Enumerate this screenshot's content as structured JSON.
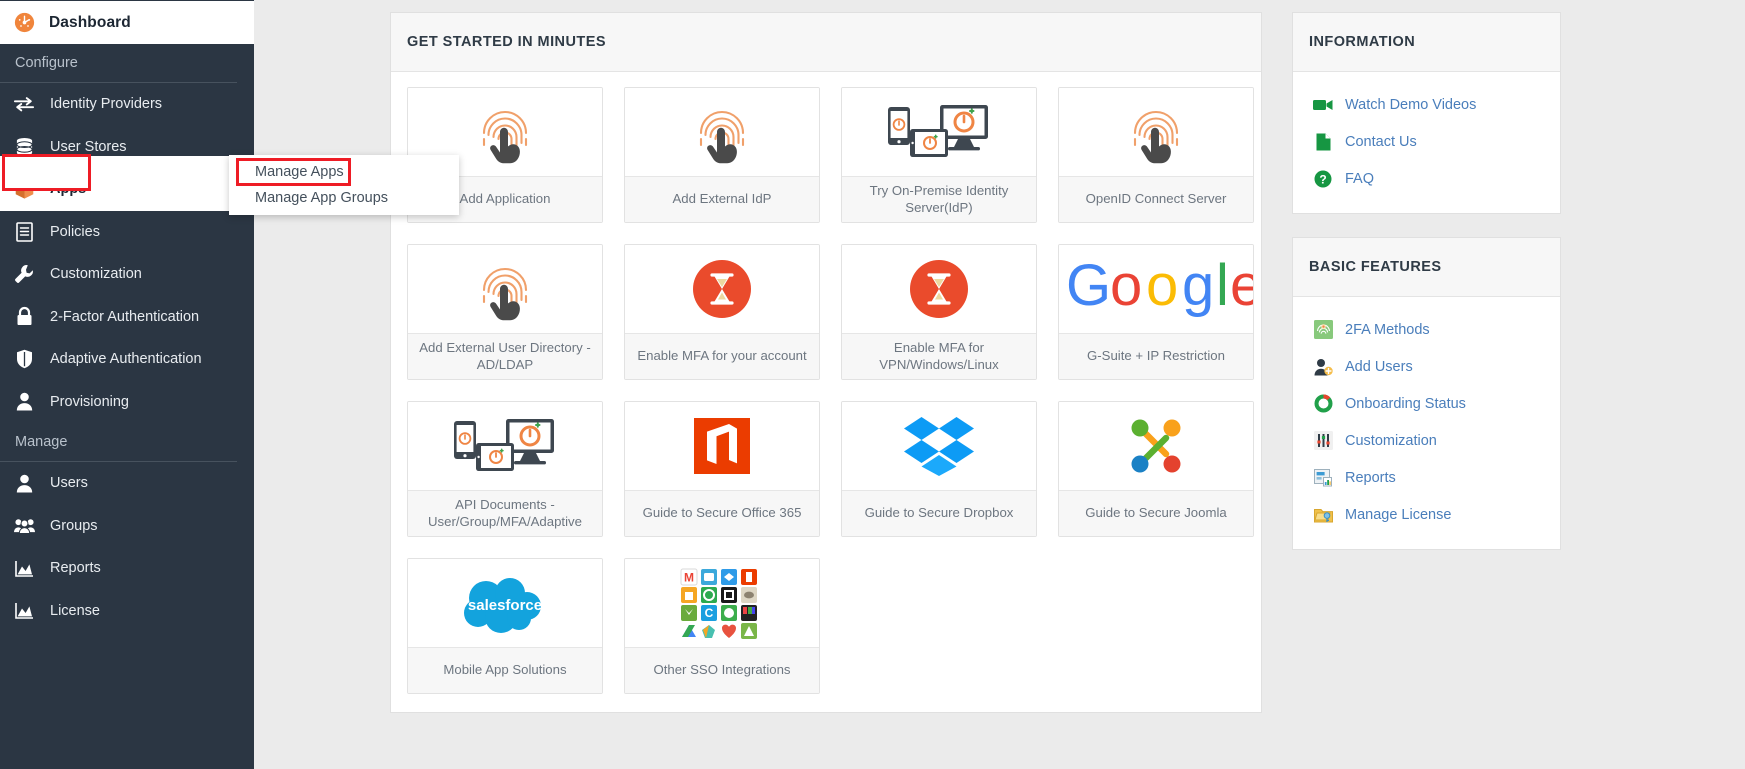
{
  "sidebar": {
    "dashboard": {
      "label": "Dashboard",
      "icon": "speedometer-icon"
    },
    "section_configure": "Configure",
    "section_manage": "Manage",
    "configure_items": [
      {
        "label": "Identity Providers",
        "icon": "exchange-arrows-icon"
      },
      {
        "label": "User Stores",
        "icon": "database-icon"
      },
      {
        "label": "Apps",
        "icon": "box-icon",
        "active": true
      },
      {
        "label": "Policies",
        "icon": "document-icon"
      },
      {
        "label": "Customization",
        "icon": "wrench-icon"
      },
      {
        "label": "2-Factor Authentication",
        "icon": "lock-icon"
      },
      {
        "label": "Adaptive Authentication",
        "icon": "shield-icon"
      },
      {
        "label": "Provisioning",
        "icon": "user-icon"
      }
    ],
    "manage_items": [
      {
        "label": "Users",
        "icon": "user-icon"
      },
      {
        "label": "Groups",
        "icon": "users-group-icon"
      },
      {
        "label": "Reports",
        "icon": "chart-area-icon"
      },
      {
        "label": "License",
        "icon": "chart-area-icon"
      }
    ]
  },
  "submenu": {
    "items": [
      {
        "label": "Manage Apps",
        "highlighted": true
      },
      {
        "label": "Manage App Groups",
        "highlighted": false
      }
    ]
  },
  "main": {
    "title": "GET STARTED IN MINUTES",
    "cards": [
      {
        "label": "Add Application",
        "icon": "fingerprint-touch-icon"
      },
      {
        "label": "Add External IdP",
        "icon": "fingerprint-touch-icon"
      },
      {
        "label": "Try On-Premise Identity Server(IdP)",
        "icon": "multi-device-icon"
      },
      {
        "label": "OpenID Connect Server",
        "icon": "fingerprint-touch-icon"
      },
      {
        "label": "Add External User Directory - AD/LDAP",
        "icon": "fingerprint-touch-icon"
      },
      {
        "label": "Enable MFA for your account",
        "icon": "hourglass-circle-icon"
      },
      {
        "label": "Enable MFA for VPN/Windows/Linux",
        "icon": "hourglass-circle-icon"
      },
      {
        "label": "G-Suite + IP Restriction",
        "icon": "google-logo-icon"
      },
      {
        "label": "API Documents - User/Group/MFA/Adaptive",
        "icon": "multi-device-icon"
      },
      {
        "label": "Guide to Secure Office 365",
        "icon": "office365-logo-icon"
      },
      {
        "label": "Guide to Secure Dropbox",
        "icon": "dropbox-logo-icon"
      },
      {
        "label": "Guide to Secure Joomla",
        "icon": "joomla-logo-icon"
      },
      {
        "label": "Mobile App Solutions",
        "icon": "salesforce-logo-icon"
      },
      {
        "label": "Other SSO Integrations",
        "icon": "app-icon-grid-icon"
      }
    ]
  },
  "information": {
    "title": "INFORMATION",
    "links": [
      {
        "label": "Watch Demo Videos",
        "icon": "video-camera-icon"
      },
      {
        "label": "Contact Us",
        "icon": "document-page-icon"
      },
      {
        "label": "FAQ",
        "icon": "question-circle-icon"
      }
    ]
  },
  "basic_features": {
    "title": "BASIC FEATURES",
    "links": [
      {
        "label": "2FA Methods",
        "icon": "fingerprint-badge-icon"
      },
      {
        "label": "Add Users",
        "icon": "add-user-icon"
      },
      {
        "label": "Onboarding Status",
        "icon": "donut-chart-icon"
      },
      {
        "label": "Customization",
        "icon": "sliders-icon"
      },
      {
        "label": "Reports",
        "icon": "report-icon"
      },
      {
        "label": "Manage License",
        "icon": "license-key-icon"
      }
    ]
  },
  "colors": {
    "sidebar_bg": "#2b3643",
    "accent_orange": "#f0853c",
    "highlight_red": "#ee1c25",
    "link_blue": "#4a7ebb",
    "icon_green": "#169642"
  }
}
